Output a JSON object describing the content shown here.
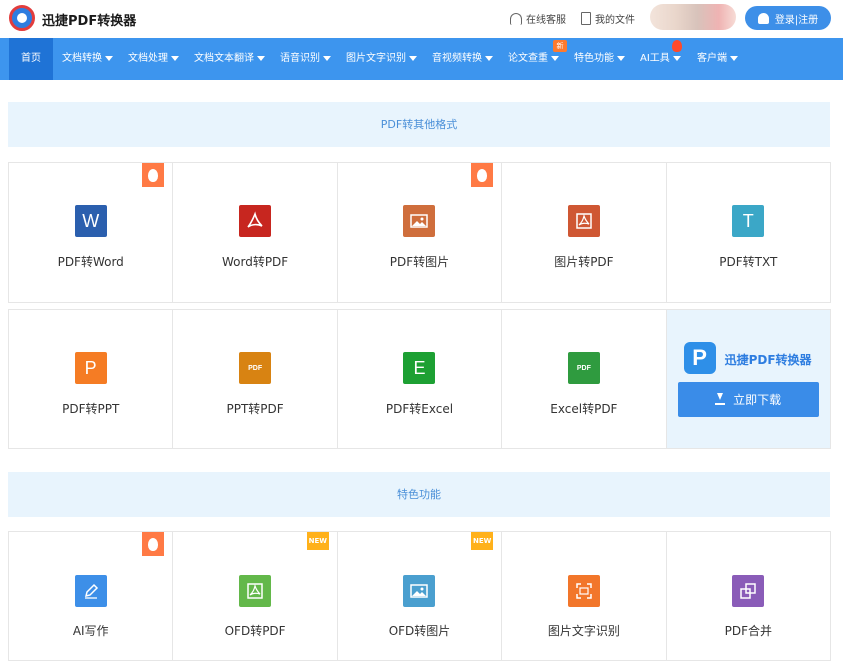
{
  "header": {
    "brand": "迅捷PDF转换器",
    "service_label": "在线客服",
    "files_label": "我的文件",
    "login_label": "登录|注册"
  },
  "nav": {
    "items": [
      {
        "label": "首页",
        "has_dropdown": false
      },
      {
        "label": "文档转换",
        "has_dropdown": true
      },
      {
        "label": "文档处理",
        "has_dropdown": true
      },
      {
        "label": "文档文本翻译",
        "has_dropdown": true
      },
      {
        "label": "语音识别",
        "has_dropdown": true
      },
      {
        "label": "图片文字识别",
        "has_dropdown": true
      },
      {
        "label": "音视频转换",
        "has_dropdown": true
      },
      {
        "label": "论文查重",
        "has_dropdown": true
      },
      {
        "label": "特色功能",
        "has_dropdown": true
      },
      {
        "label": "AI工具",
        "has_dropdown": true
      },
      {
        "label": "客户端",
        "has_dropdown": true
      }
    ],
    "new_badge": "新"
  },
  "sections": {
    "convert": "PDF转其他格式",
    "featured": "特色功能"
  },
  "tools_row1": [
    {
      "label": "PDF转Word",
      "icon": "word-icon",
      "color": "#2b5fae",
      "glyph": "W",
      "badge": "hot"
    },
    {
      "label": "Word转PDF",
      "icon": "pdf-icon",
      "color": "#c7261f",
      "glyph": "",
      "badge": ""
    },
    {
      "label": "PDF转图片",
      "icon": "image-icon",
      "color": "#cf6e3c",
      "glyph": "",
      "badge": "hot"
    },
    {
      "label": "图片转PDF",
      "icon": "pdf-icon",
      "color": "#cf5733",
      "glyph": "",
      "badge": ""
    },
    {
      "label": "PDF转TXT",
      "icon": "text-icon",
      "color": "#3ba7c7",
      "glyph": "T",
      "badge": ""
    }
  ],
  "tools_row2": [
    {
      "label": "PDF转PPT",
      "icon": "ppt-icon",
      "color": "#f57c24",
      "glyph": "P"
    },
    {
      "label": "PPT转PDF",
      "icon": "pdf-slide-icon",
      "color": "#d88312",
      "glyph": "PDF"
    },
    {
      "label": "PDF转Excel",
      "icon": "excel-icon",
      "color": "#1da033",
      "glyph": "E"
    },
    {
      "label": "Excel转PDF",
      "icon": "pdf-doc-icon",
      "color": "#2f9b3f",
      "glyph": "PDF"
    }
  ],
  "promo": {
    "logo_glyph": "P",
    "name": "迅捷PDF转换器",
    "button_label": "立即下载"
  },
  "tools_row3": [
    {
      "label": "AI写作",
      "icon": "pen-icon",
      "color": "#3d8fe8",
      "badge": "hot"
    },
    {
      "label": "OFD转PDF",
      "icon": "pdf-icon",
      "color": "#63b84a",
      "badge": "NEW"
    },
    {
      "label": "OFD转图片",
      "icon": "image-icon",
      "color": "#4a9fcf",
      "badge": "NEW"
    },
    {
      "label": "图片文字识别",
      "icon": "scan-icon",
      "color": "#f2762a",
      "badge": ""
    },
    {
      "label": "PDF合并",
      "icon": "merge-icon",
      "color": "#8a5cb8",
      "badge": ""
    }
  ]
}
